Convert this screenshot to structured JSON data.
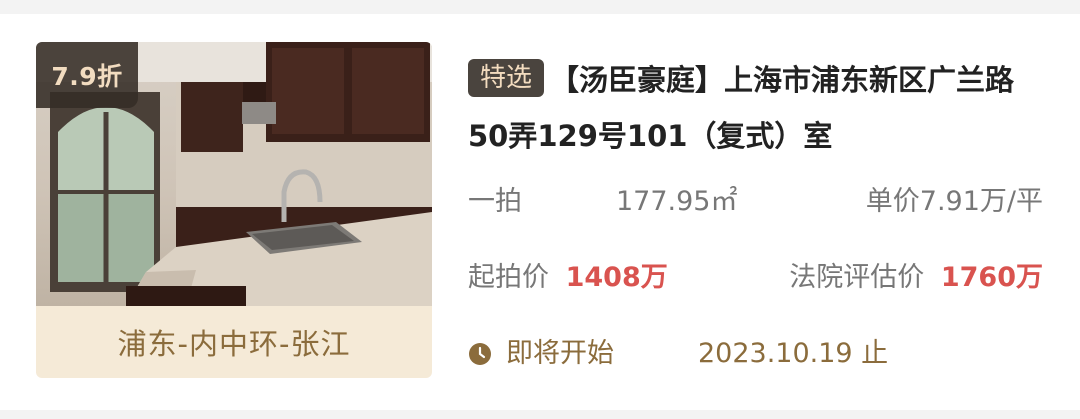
{
  "listing": {
    "discount": "7.9折",
    "location": "浦东-内中环-张江",
    "tag": "特选",
    "title": "【汤臣豪庭】上海市浦东新区广兰路50弄129号101（复式）室",
    "auction_round": "一拍",
    "area": "177.95㎡",
    "unit_price": "单价7.91万/平",
    "start_price_label": "起拍价",
    "start_price": "1408万",
    "valuation_label": "法院评估价",
    "valuation": "1760万",
    "status": "即将开始",
    "end_date": "2023.10.19 止"
  },
  "colors": {
    "accent_red": "#d9534f",
    "gold": "#8b6c3c",
    "tag_bg": "#4a443e"
  }
}
